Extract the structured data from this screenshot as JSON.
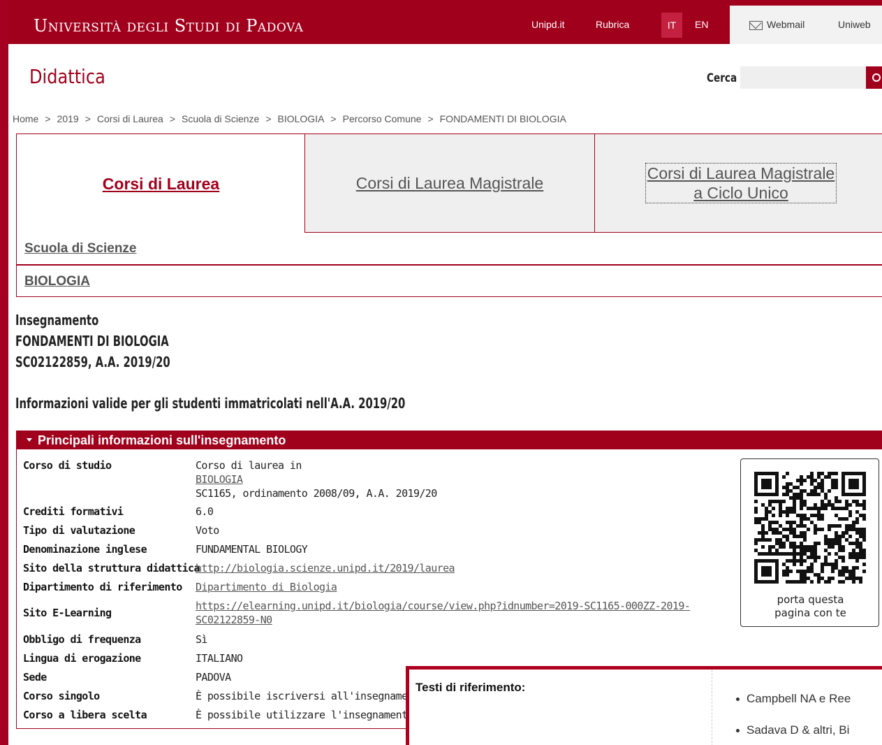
{
  "header": {
    "university": "Università degli Studi di Padova",
    "links": [
      "Unipd.it",
      "Rubrica"
    ],
    "lang_it": "IT",
    "lang_en": "EN",
    "webmail": "Webmail",
    "uniweb": "Uniweb"
  },
  "title": "Didattica",
  "search": {
    "label": "Cerca",
    "value": ""
  },
  "breadcrumb": [
    "Home",
    "2019",
    "Corsi di Laurea",
    "Scuola di Scienze",
    "BIOLOGIA",
    "Percorso Comune",
    "FONDAMENTI DI BIOLOGIA"
  ],
  "tabs": {
    "laurea": "Corsi di Laurea",
    "magistrale": "Corsi di Laurea Magistrale",
    "ciclo_line1": "Corsi di Laurea Magistrale",
    "ciclo_line2": "a Ciclo Unico"
  },
  "nav_rows": {
    "scuola": "Scuola di Scienze",
    "corso": "BIOLOGIA"
  },
  "insegnamento": {
    "label": "Insegnamento",
    "name": "FONDAMENTI DI BIOLOGIA",
    "code": "SC02122859, A.A. 2019/20",
    "note": "Informazioni valide per gli studenti immatricolati nell'A.A. 2019/20"
  },
  "panel": {
    "title": "Principali informazioni sull'insegnamento",
    "corso_label": "Corso di studio",
    "corso_line1": "Corso di laurea in",
    "corso_link": "BIOLOGIA",
    "corso_line3": "SC1165, ordinamento 2008/09, A.A. 2019/20",
    "crediti_label": "Crediti formativi",
    "crediti": "6.0",
    "tipo_label": "Tipo di valutazione",
    "tipo": "Voto",
    "denom_label": "Denominazione inglese",
    "denom": "FUNDAMENTAL BIOLOGY",
    "sito_label": "Sito della struttura didattica",
    "sito": "http://biologia.scienze.unipd.it/2019/laurea",
    "dip_label": "Dipartimento di riferimento",
    "dip": "Dipartimento di Biologia",
    "elearn_label": "Sito E-Learning",
    "elearn_line1": "https://elearning.unipd.it/biologia/course/view.php?idnumber=2019-SC1165-000ZZ-2019-",
    "elearn_line2": "SC02122859-N0",
    "obbligo_label": "Obbligo di frequenza",
    "obbligo": "Sì",
    "lingua_label": "Lingua di erogazione",
    "lingua": "ITALIANO",
    "sede_label": "Sede",
    "sede": "PADOVA",
    "singolo_label": "Corso singolo",
    "singolo": "È possibile iscriversi all'insegnamento",
    "libera_label": "Corso a libera scelta",
    "libera": "È possibile utilizzare l'insegnamento"
  },
  "qr": {
    "caption_line1": "porta questa",
    "caption_line2": "pagina con te"
  },
  "popup": {
    "title": "Testi di riferimento:",
    "items": [
      "Campbell NA e Ree",
      "Sadava D & altri, Bi"
    ]
  }
}
